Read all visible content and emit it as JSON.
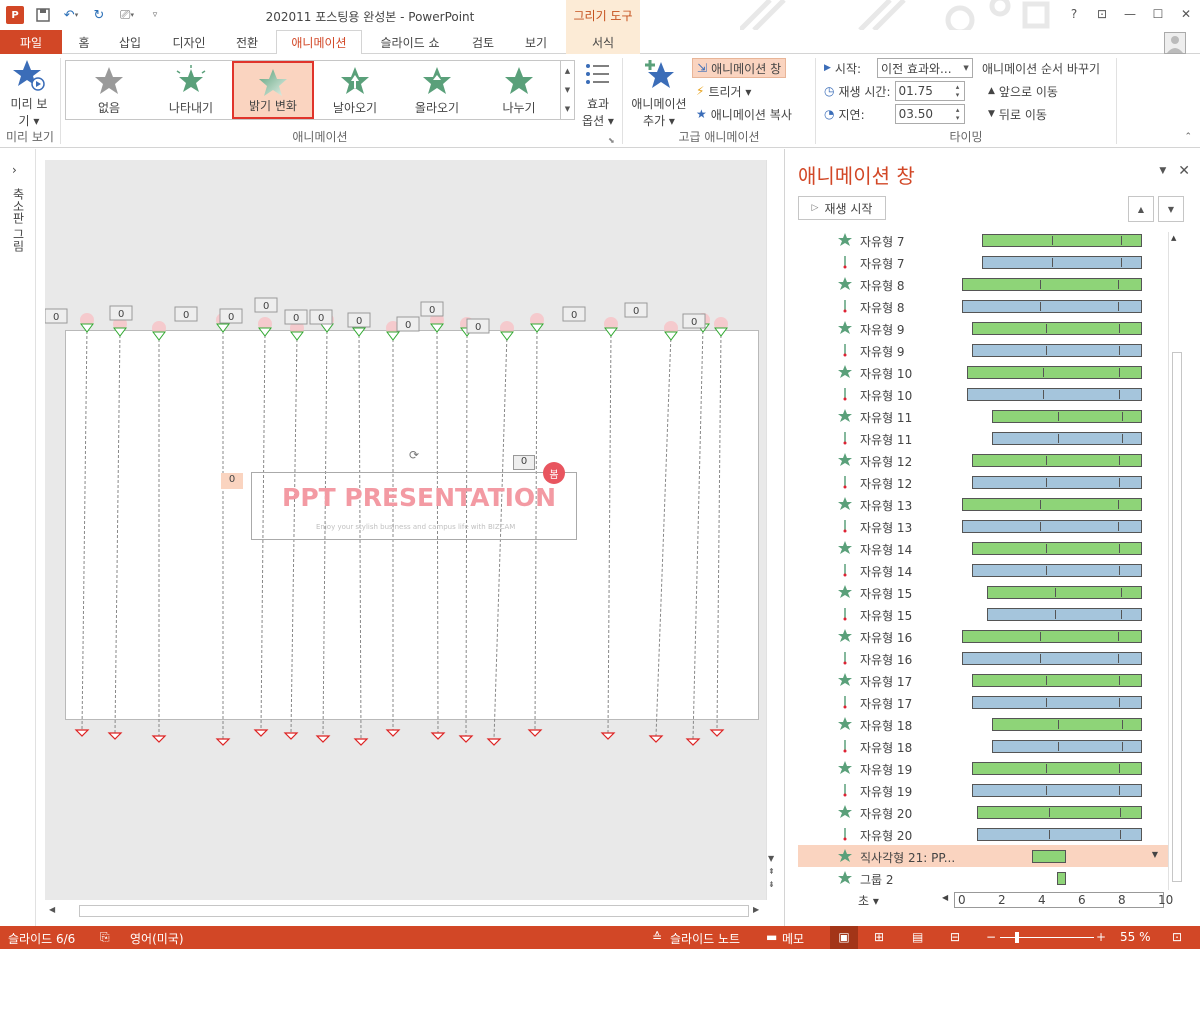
{
  "title_bar": {
    "title": "202011 포스팅용 완성본 - PowerPoint",
    "contextual_tab_group": "그리기 도구",
    "help": "?",
    "minimize": "—",
    "maximize": "☐",
    "close": "✕"
  },
  "tabs": [
    "파일",
    "홈",
    "삽입",
    "디자인",
    "전환",
    "애니메이션",
    "슬라이드 쇼",
    "검토",
    "보기",
    "서식"
  ],
  "active_tab": "애니메이션",
  "ribbon": {
    "preview": {
      "label_line1": "미리 보",
      "label_line2": "기 ▾",
      "group": "미리 보기"
    },
    "animation_gallery": {
      "items": [
        "없음",
        "나타내기",
        "밝기 변화",
        "날아오기",
        "올라오기",
        "나누기"
      ],
      "selected": "밝기 변화",
      "group": "애니메이션"
    },
    "effect_options": {
      "line1": "효과",
      "line2": "옵션 ▾"
    },
    "advanced": {
      "add_animation_line1": "애니메이션",
      "add_animation_line2": "추가 ▾",
      "animation_pane": "애니메이션 창",
      "trigger": "트리거 ▾",
      "animation_painter": "애니메이션 복사",
      "group": "고급 애니메이션"
    },
    "timing": {
      "start_label": "시작:",
      "start_value": "이전 효과와...",
      "duration_label": "재생 시간:",
      "duration_value": "01.75",
      "delay_label": "지연:",
      "delay_value": "03.50",
      "reorder_title": "애니메이션 순서 바꾸기",
      "move_earlier": "앞으로 이동",
      "move_later": "뒤로 이동",
      "group": "타이밍"
    }
  },
  "thumbnail_pane": {
    "label": "축소판 그림",
    "expand": "›"
  },
  "slide": {
    "title": "PPT PRESENTATION",
    "subtitle": "Enjoy your stylish business and campus life with BIZCAM",
    "tag_text": "봄",
    "badge_value": "0",
    "title_badge": "0",
    "left_badge": "0"
  },
  "animation_pane": {
    "title": "애니메이션 창",
    "play_button": "재생 시작",
    "items": [
      {
        "label": "자유형 7",
        "type": "entrance"
      },
      {
        "label": "자유형 7",
        "type": "motion"
      },
      {
        "label": "자유형 8",
        "type": "entrance"
      },
      {
        "label": "자유형 8",
        "type": "motion"
      },
      {
        "label": "자유형 9",
        "type": "entrance"
      },
      {
        "label": "자유형 9",
        "type": "motion"
      },
      {
        "label": "자유형 10",
        "type": "entrance"
      },
      {
        "label": "자유형 10",
        "type": "motion"
      },
      {
        "label": "자유형 11",
        "type": "entrance"
      },
      {
        "label": "자유형 11",
        "type": "motion"
      },
      {
        "label": "자유형 12",
        "type": "entrance"
      },
      {
        "label": "자유형 12",
        "type": "motion"
      },
      {
        "label": "자유형 13",
        "type": "entrance"
      },
      {
        "label": "자유형 13",
        "type": "motion"
      },
      {
        "label": "자유형 14",
        "type": "entrance"
      },
      {
        "label": "자유형 14",
        "type": "motion"
      },
      {
        "label": "자유형 15",
        "type": "entrance"
      },
      {
        "label": "자유형 15",
        "type": "motion"
      },
      {
        "label": "자유형 16",
        "type": "entrance"
      },
      {
        "label": "자유형 16",
        "type": "motion"
      },
      {
        "label": "자유형 17",
        "type": "entrance"
      },
      {
        "label": "자유형 17",
        "type": "motion"
      },
      {
        "label": "자유형 18",
        "type": "entrance"
      },
      {
        "label": "자유형 18",
        "type": "motion"
      },
      {
        "label": "자유형 19",
        "type": "entrance"
      },
      {
        "label": "자유형 19",
        "type": "motion"
      },
      {
        "label": "자유형 20",
        "type": "entrance"
      },
      {
        "label": "자유형 20",
        "type": "motion"
      },
      {
        "label": "직사각형 21: PP...",
        "type": "entrance",
        "selected": true
      },
      {
        "label": "그룹 2",
        "type": "entrance"
      }
    ],
    "seconds_label": "초 ▾",
    "ruler_ticks": [
      "0",
      "2",
      "4",
      "6",
      "8",
      "10"
    ]
  },
  "status_bar": {
    "slide_info": "슬라이드 6/6",
    "language": "영어(미국)",
    "notes": "슬라이드 노트",
    "comments": "메모",
    "zoom": "55 %"
  },
  "colors": {
    "accent": "#d24726",
    "entrance_bar": "#8ed478",
    "motion_bar": "#a5c5dc",
    "selected_bg": "#fad4c0",
    "star_green": "#5aa07a"
  }
}
